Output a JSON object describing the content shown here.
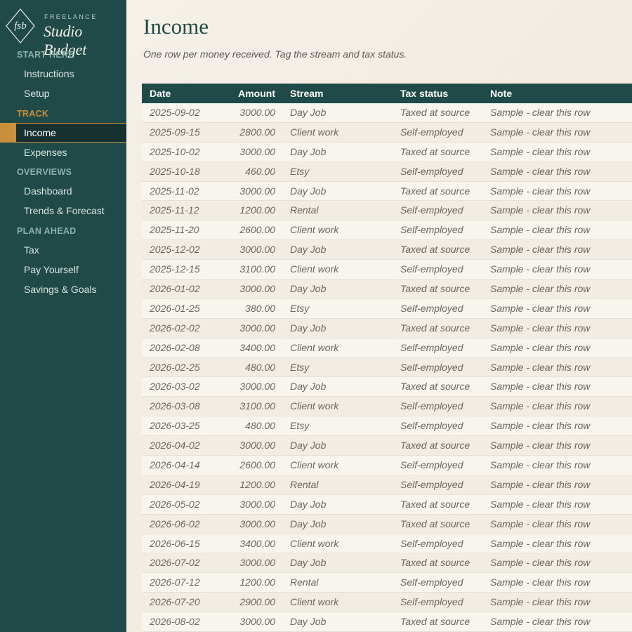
{
  "brand": {
    "monogram": "fsb",
    "kicker": "FREELANCE",
    "name": "Studio Budget"
  },
  "sidebar": {
    "sections": [
      {
        "label": "START HERE",
        "items": [
          "Instructions",
          "Setup"
        ]
      },
      {
        "label": "TRACK",
        "items": [
          "Income",
          "Expenses"
        ]
      },
      {
        "label": "OVERVIEWS",
        "items": [
          "Dashboard",
          "Trends & Forecast"
        ]
      },
      {
        "label": "PLAN AHEAD",
        "items": [
          "Tax",
          "Pay Yourself",
          "Savings & Goals"
        ]
      }
    ],
    "active_item": "Income"
  },
  "main": {
    "title": "Income",
    "subtitle": "One row per money received. Tag the stream and tax status."
  },
  "table": {
    "columns": [
      "Date",
      "Amount",
      "Stream",
      "Tax status",
      "Note"
    ],
    "rows": [
      [
        "2025-09-02",
        "3000.00",
        "Day Job",
        "Taxed at source",
        "Sample - clear this row"
      ],
      [
        "2025-09-15",
        "2800.00",
        "Client work",
        "Self-employed",
        "Sample - clear this row"
      ],
      [
        "2025-10-02",
        "3000.00",
        "Day Job",
        "Taxed at source",
        "Sample - clear this row"
      ],
      [
        "2025-10-18",
        "460.00",
        "Etsy",
        "Self-employed",
        "Sample - clear this row"
      ],
      [
        "2025-11-02",
        "3000.00",
        "Day Job",
        "Taxed at source",
        "Sample - clear this row"
      ],
      [
        "2025-11-12",
        "1200.00",
        "Rental",
        "Self-employed",
        "Sample - clear this row"
      ],
      [
        "2025-11-20",
        "2600.00",
        "Client work",
        "Self-employed",
        "Sample - clear this row"
      ],
      [
        "2025-12-02",
        "3000.00",
        "Day Job",
        "Taxed at source",
        "Sample - clear this row"
      ],
      [
        "2025-12-15",
        "3100.00",
        "Client work",
        "Self-employed",
        "Sample - clear this row"
      ],
      [
        "2026-01-02",
        "3000.00",
        "Day Job",
        "Taxed at source",
        "Sample - clear this row"
      ],
      [
        "2026-01-25",
        "380.00",
        "Etsy",
        "Self-employed",
        "Sample - clear this row"
      ],
      [
        "2026-02-02",
        "3000.00",
        "Day Job",
        "Taxed at source",
        "Sample - clear this row"
      ],
      [
        "2026-02-08",
        "3400.00",
        "Client work",
        "Self-employed",
        "Sample - clear this row"
      ],
      [
        "2026-02-25",
        "480.00",
        "Etsy",
        "Self-employed",
        "Sample - clear this row"
      ],
      [
        "2026-03-02",
        "3000.00",
        "Day Job",
        "Taxed at source",
        "Sample - clear this row"
      ],
      [
        "2026-03-08",
        "3100.00",
        "Client work",
        "Self-employed",
        "Sample - clear this row"
      ],
      [
        "2026-03-25",
        "480.00",
        "Etsy",
        "Self-employed",
        "Sample - clear this row"
      ],
      [
        "2026-04-02",
        "3000.00",
        "Day Job",
        "Taxed at source",
        "Sample - clear this row"
      ],
      [
        "2026-04-14",
        "2600.00",
        "Client work",
        "Self-employed",
        "Sample - clear this row"
      ],
      [
        "2026-04-19",
        "1200.00",
        "Rental",
        "Self-employed",
        "Sample - clear this row"
      ],
      [
        "2026-05-02",
        "3000.00",
        "Day Job",
        "Taxed at source",
        "Sample - clear this row"
      ],
      [
        "2026-06-02",
        "3000.00",
        "Day Job",
        "Taxed at source",
        "Sample - clear this row"
      ],
      [
        "2026-06-15",
        "3400.00",
        "Client work",
        "Self-employed",
        "Sample - clear this row"
      ],
      [
        "2026-07-02",
        "3000.00",
        "Day Job",
        "Taxed at source",
        "Sample - clear this row"
      ],
      [
        "2026-07-12",
        "1200.00",
        "Rental",
        "Self-employed",
        "Sample - clear this row"
      ],
      [
        "2026-07-20",
        "2900.00",
        "Client work",
        "Self-employed",
        "Sample - clear this row"
      ],
      [
        "2026-08-02",
        "3000.00",
        "Day Job",
        "Taxed at source",
        "Sample - clear this row"
      ]
    ]
  },
  "colors": {
    "sidebar_bg": "#1f4a47",
    "accent": "#c98f3a",
    "header_bg": "#1f4a47",
    "page_bg": "#f3eee6"
  }
}
